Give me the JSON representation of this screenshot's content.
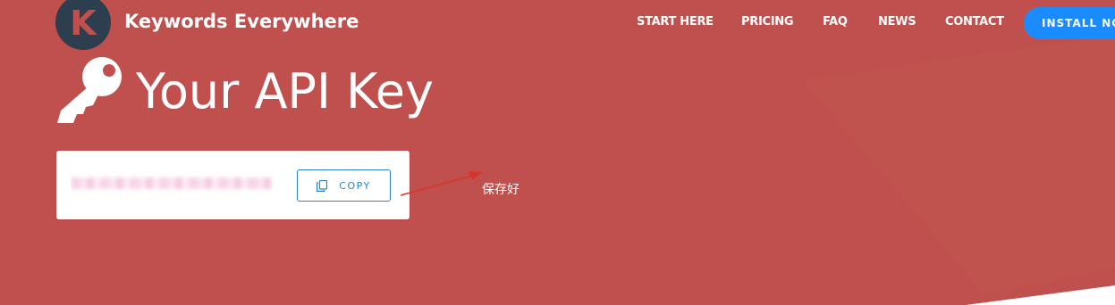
{
  "colors": {
    "hero_background": "#c0504d",
    "logo_background": "#2d3e4e",
    "install_button": "#1a8cff",
    "copy_accent": "#2b84c6",
    "annotation_arrow": "#d9342b"
  },
  "header": {
    "logo_letter": "K",
    "brand_name": "Keywords Everywhere",
    "nav": [
      {
        "label": "START HERE"
      },
      {
        "label": "PRICING"
      },
      {
        "label": "FAQ"
      },
      {
        "label": "NEWS"
      },
      {
        "label": "CONTACT"
      }
    ],
    "install_label": "INSTALL NOW"
  },
  "main": {
    "title_icon": "key-icon",
    "title": "Your API Key",
    "api_key_card": {
      "masked_value": "",
      "copy_icon": "copy-icon",
      "copy_label": "COPY"
    }
  },
  "annotation": {
    "note": "保存好"
  }
}
